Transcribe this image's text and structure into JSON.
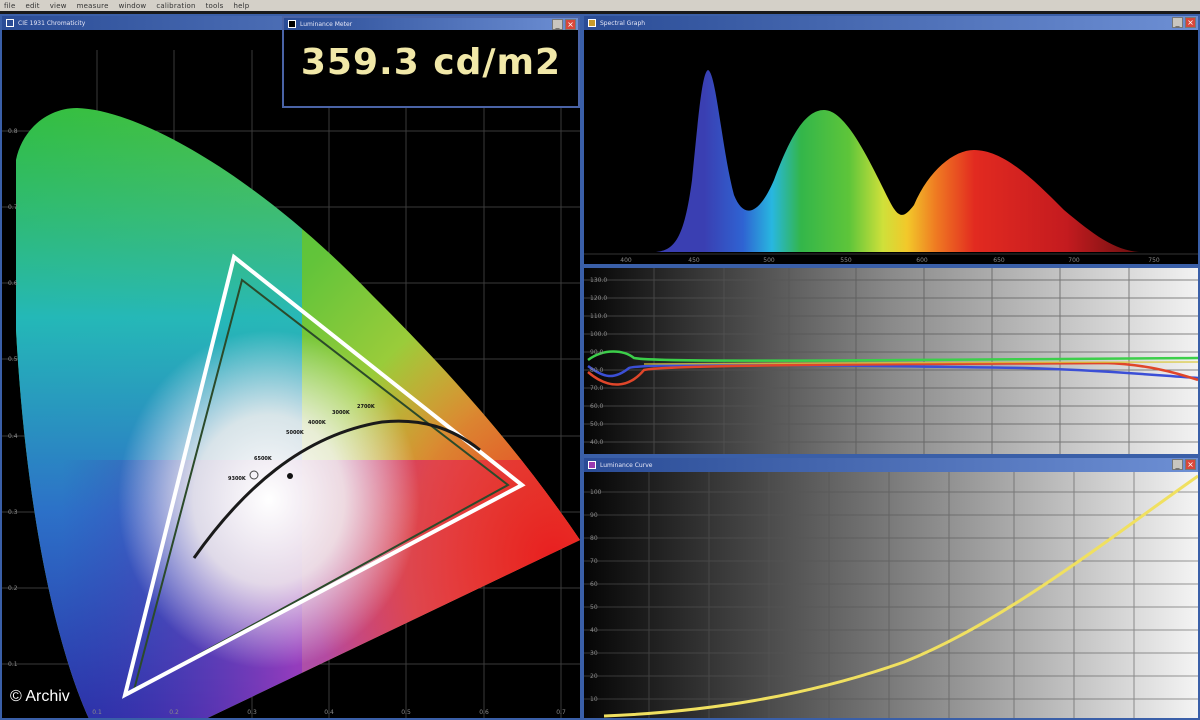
{
  "menubar": {
    "items": [
      "file",
      "edit",
      "view",
      "measure",
      "window",
      "calibration",
      "tools",
      "help"
    ]
  },
  "cie_window": {
    "title": "CIE 1931 Chromaticity",
    "x_ticks": [
      "0.1",
      "0.2",
      "0.3",
      "0.4",
      "0.5",
      "0.6",
      "0.7"
    ],
    "y_ticks": [
      "0.8",
      "0.7",
      "0.6",
      "0.5",
      "0.4",
      "0.3",
      "0.2",
      "0.1"
    ],
    "cct_labels": [
      "2700K",
      "3000K",
      "4000K",
      "5000K",
      "6500K",
      "9300K"
    ]
  },
  "luminance_window": {
    "title": "Luminance Meter",
    "value": "359.3 cd/m2"
  },
  "spectral_window": {
    "title": "Spectral Graph",
    "x_ticks": [
      "400",
      "450",
      "500",
      "550",
      "600",
      "650",
      "700",
      "750"
    ]
  },
  "rgb_window": {
    "y_ticks": [
      "130.0",
      "120.0",
      "110.0",
      "100.0",
      "90.0",
      "80.0",
      "70.0",
      "60.0",
      "50.0",
      "40.0"
    ]
  },
  "gamma_window": {
    "title": "Luminance Curve",
    "y_ticks": [
      "100",
      "90",
      "80",
      "70",
      "60",
      "50",
      "40",
      "30",
      "20",
      "10"
    ]
  },
  "credit": "© Archiv",
  "colors": {
    "titlebar": "#2a4c96",
    "luminance_text": "#f1e8a8",
    "gamma_curve": "#f0e060"
  }
}
